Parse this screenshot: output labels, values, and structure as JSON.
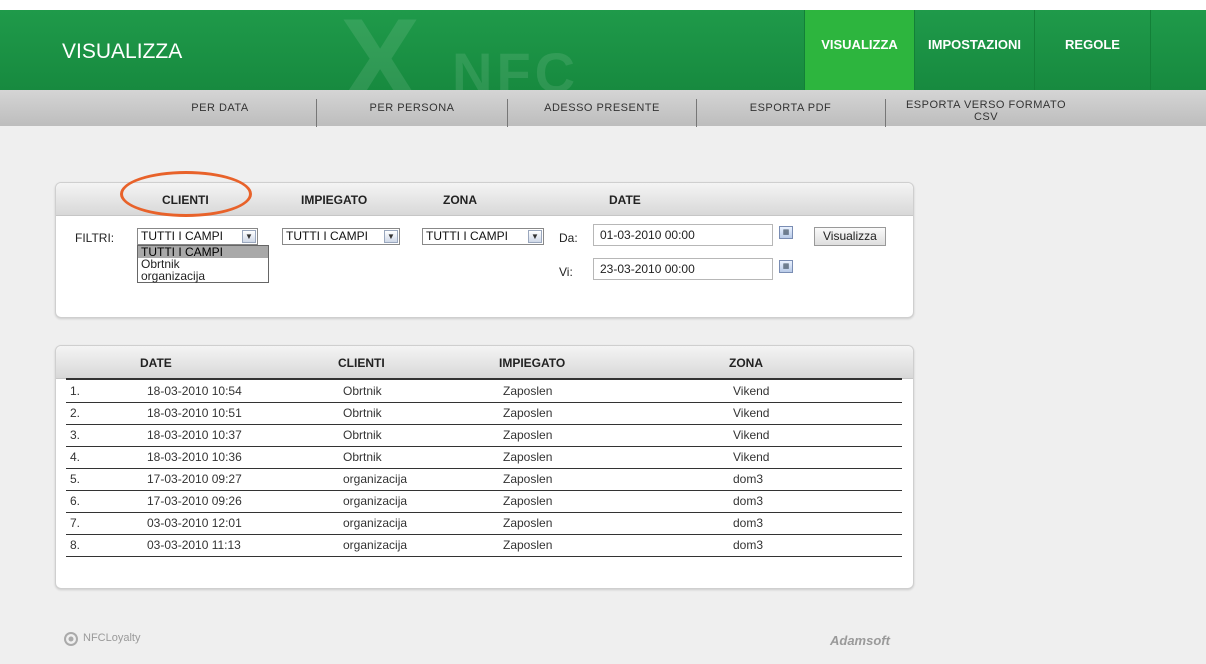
{
  "header": {
    "page_title": "VISUALIZZA",
    "background_text": "NFC",
    "nav": [
      "VISUALIZZA",
      "IMPOSTAZIONI",
      "REGOLE"
    ],
    "active_nav": "VISUALIZZA",
    "accent": "#1f9a4a",
    "active_color": "#2db53e"
  },
  "subnav": {
    "items": [
      "PER DATA",
      "PER PERSONA",
      "ADESSO PRESENTE",
      "ESPORTA PDF",
      "ESPORTA VERSO FORMATO",
      "CSV"
    ]
  },
  "filters": {
    "tabs": [
      "CLIENTI",
      "IMPIEGATO",
      "ZONA",
      "DATE"
    ],
    "label": "FILTRI:",
    "clienti_value": "TUTTI I CAMPI",
    "impiegato_value": "TUTTI I CAMPI",
    "zona_value": "TUTTI I CAMPI",
    "dropdown_options": [
      "TUTTI I CAMPI",
      "Obrtnik",
      "organizacija"
    ],
    "from_label": "Da:",
    "from_value": "01-03-2010 00:00",
    "to_label": "Vi:",
    "to_value": "23-03-2010 00:00",
    "submit_label": "Visualizza",
    "highlight_color": "#e8622a"
  },
  "results": {
    "columns": [
      "DATE",
      "CLIENTI",
      "IMPIEGATO",
      "ZONA"
    ],
    "rows": [
      [
        "1.",
        "18-03-2010 10:54",
        "Obrtnik",
        "Zaposlen",
        "Vikend"
      ],
      [
        "2.",
        "18-03-2010 10:51",
        "Obrtnik",
        "Zaposlen",
        "Vikend"
      ],
      [
        "3.",
        "18-03-2010 10:37",
        "Obrtnik",
        "Zaposlen",
        "Vikend"
      ],
      [
        "4.",
        "18-03-2010 10:36",
        "Obrtnik",
        "Zaposlen",
        "Vikend"
      ],
      [
        "5.",
        "17-03-2010 09:27",
        "organizacija",
        "Zaposlen",
        "dom3"
      ],
      [
        "6.",
        "17-03-2010 09:26",
        "organizacija",
        "Zaposlen",
        "dom3"
      ],
      [
        "7.",
        "03-03-2010 12:01",
        "organizacija",
        "Zaposlen",
        "dom3"
      ],
      [
        "8.",
        "03-03-2010 11:13",
        "organizacija",
        "Zaposlen",
        "dom3"
      ]
    ]
  },
  "footer": {
    "left_logo": "NFCLoyalty",
    "right_logo": "Adamsoft"
  }
}
